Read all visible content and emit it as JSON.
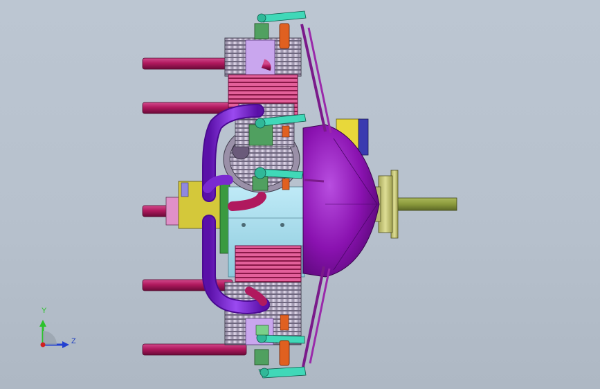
{
  "viewport": {
    "background": "#b9c3cf"
  },
  "model": {
    "parts": [
      {
        "name": "exhaust-pipes",
        "color": "#b0195e"
      },
      {
        "name": "crankcase-cover",
        "color": "#8a12b0"
      },
      {
        "name": "propeller-hub",
        "color": "#c8c878"
      },
      {
        "name": "propeller-shaft",
        "color": "#8b9a3c"
      },
      {
        "name": "cylinder-fins",
        "color": "#c8bed6"
      },
      {
        "name": "cylinder-head-pink",
        "color": "#e0508a"
      },
      {
        "name": "crankcase-block",
        "color": "#a8dcec"
      },
      {
        "name": "intake-manifold",
        "color": "#7a2ad0"
      },
      {
        "name": "rocker-arms",
        "color": "#40d8b8"
      },
      {
        "name": "pushrods",
        "color": "#7a1a8a"
      },
      {
        "name": "carburetor",
        "color": "#d4c83a"
      },
      {
        "name": "valve-springs",
        "color": "#50a060"
      },
      {
        "name": "rocker-posts",
        "color": "#e06020"
      }
    ]
  },
  "triad": {
    "y_label": "Y",
    "z_label": "Z",
    "y_color": "#2cc22c",
    "z_color": "#2240d0",
    "origin_color": "#d02020"
  }
}
